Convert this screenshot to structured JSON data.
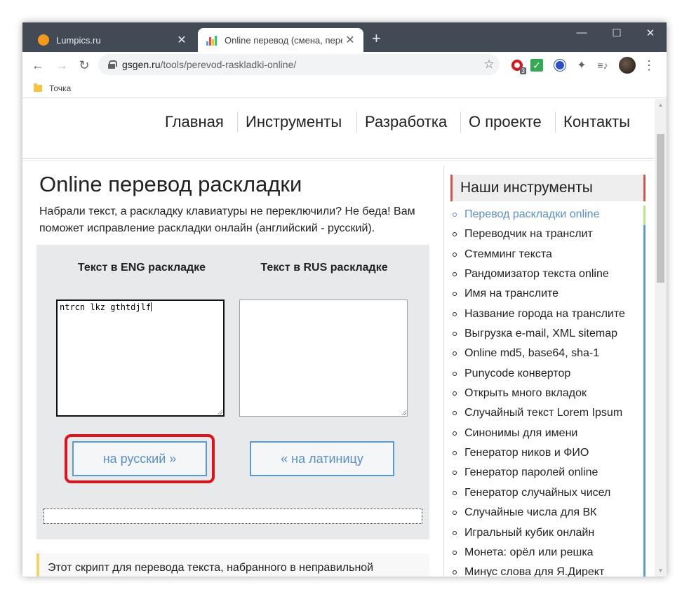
{
  "browser": {
    "tabs": [
      {
        "title": "Lumpics.ru",
        "active": false
      },
      {
        "title": "Online перевод (смена, перекл",
        "active": true
      }
    ],
    "close_glyph": "✕",
    "new_tab_glyph": "+",
    "window_controls": {
      "minimize": "—",
      "maximize": "☐",
      "close": "✕"
    },
    "nav": {
      "back": "←",
      "forward": "→",
      "reload": "↻"
    },
    "url_host": "gsgen.ru",
    "url_path": "/tools/perevod-raskladki-online/",
    "star": "☆",
    "extensions": {
      "opera_badge": "3",
      "check": "✓",
      "puzzle": "✦",
      "media": "≡♪",
      "menu": "⋮"
    },
    "bookmarks": [
      {
        "label": "Точка"
      }
    ]
  },
  "site_nav": {
    "items": [
      "Главная",
      "Инструменты",
      "Разработка",
      "О проекте",
      "Контакты"
    ]
  },
  "main": {
    "title": "Online перевод раскладки",
    "intro": "Набрали текст, а раскладку клавиатуры не переключили? Не беда! Вам поможет исправление раскладки онлайн (английский - русский).",
    "eng_label": "Текст в ENG раскладке",
    "rus_label": "Текст в RUS раскладке",
    "eng_value": "ntrcn lkz gthtdjlf",
    "rus_value": "",
    "btn_to_russian": "на русский »",
    "btn_to_latin": "« на латиницу",
    "info_text": "Этот скрипт для перевода текста, набранного в неправильной"
  },
  "sidebar": {
    "title": "Наши инструменты",
    "items": [
      "Перевод раскладки online",
      "Переводчик на транслит",
      "Стемминг текста",
      "Рандомизатор текста online",
      "Имя на транслите",
      "Название города на транслите",
      "Выгрузка e-mail, XML sitemap",
      "Online md5, base64, sha-1",
      "Punycode конвертор",
      "Открыть много вкладок",
      "Случайный текст Lorem Ipsum",
      "Синонимы для имени",
      "Генератор ников и ФИО",
      "Генератор паролей online",
      "Генератор случайных чисел",
      "Случайные числа для ВК",
      "Игральный кубик онлайн",
      "Монета: орёл или решка",
      "Минус слова для Я.Директ"
    ]
  },
  "colors": {
    "tab_strip": "#414a55",
    "accent_blue": "#5b9bd5",
    "highlight_red": "#e0121c",
    "tool_bg": "#e8e9eb"
  }
}
